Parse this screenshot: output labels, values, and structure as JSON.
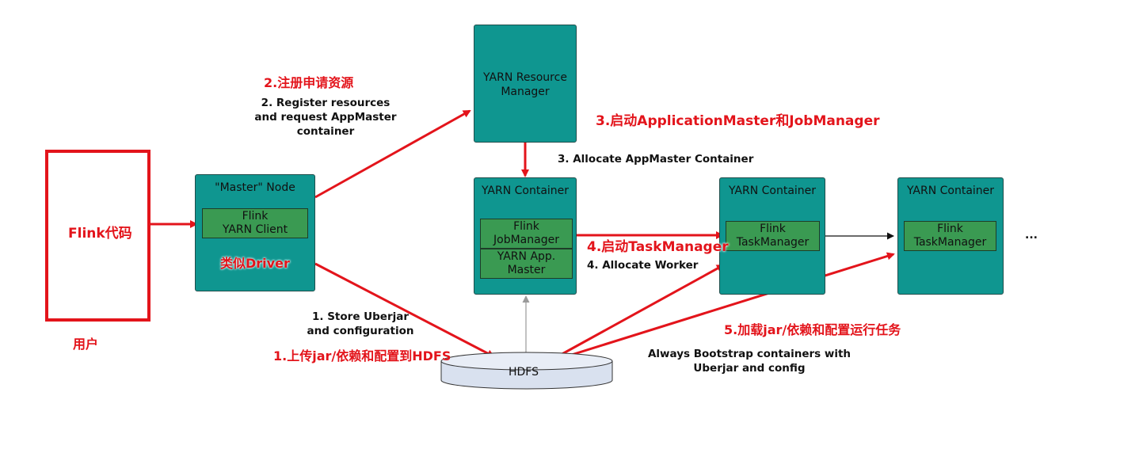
{
  "user_box": {
    "code_label": "Flink代码",
    "user_label": "用户"
  },
  "master_node": {
    "title": "\"Master\" Node",
    "client_line1": "Flink",
    "client_line2": "YARN Client",
    "driver_label": "类似Driver"
  },
  "resource_manager": {
    "line1": "YARN Resource",
    "line2": "Manager"
  },
  "am_container": {
    "title": "YARN Container",
    "jm_line1": "Flink",
    "jm_line2": "JobManager",
    "app_line1": "YARN App.",
    "app_line2": "Master"
  },
  "tm_container_1": {
    "title": "YARN Container",
    "tm_line1": "Flink",
    "tm_line2": "TaskManager"
  },
  "tm_container_2": {
    "title": "YARN Container",
    "tm_line1": "Flink",
    "tm_line2": "TaskManager"
  },
  "ellipsis": "...",
  "hdfs": {
    "label": "HDFS"
  },
  "annotations": {
    "step2_cn": "2.注册申请资源",
    "step2_en_1": "2. Register resources",
    "step2_en_2": "and request AppMaster",
    "step2_en_3": "container",
    "step3_cn": "3.启动ApplicationMaster和JobManager",
    "step3_en": "3. Allocate AppMaster Container",
    "step4_cn": "4.启动TaskManager",
    "step4_en": "4. Allocate Worker",
    "step1_en_1": "1. Store Uberjar",
    "step1_en_2": "and configuration",
    "step1_cn": "1.上传jar/依赖和配置到HDFS",
    "step5_cn": "5.加载jar/依赖和配置运行任务",
    "bootstrap_1": "Always Bootstrap containers with",
    "bootstrap_2": "Uberjar and config"
  },
  "colors": {
    "teal": "#0f9690",
    "green": "#3a9a52",
    "red": "#e3141b",
    "hdfs_fill": "#d9e1ef"
  }
}
